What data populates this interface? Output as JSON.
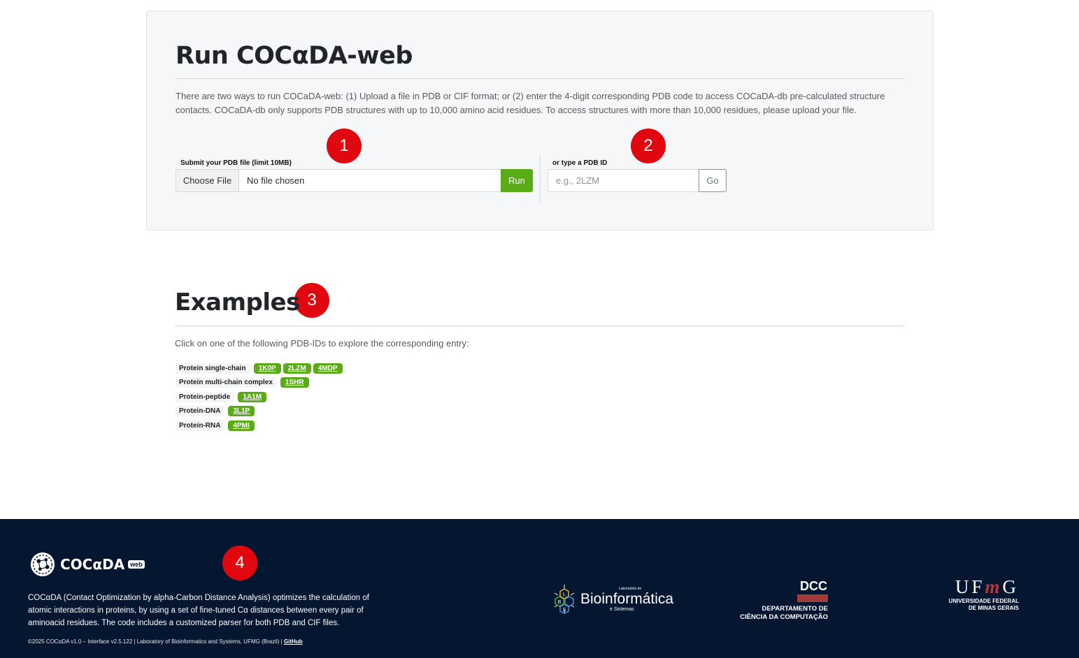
{
  "run": {
    "title": "Run COCαDA-web",
    "description": "There are two ways to run COCaDA-web: (1) Upload a file in PDB or CIF format; or (2) enter the 4-digit corresponding PDB code to access COCaDA-db pre-calculated structure contacts. COCaDA-db only supports PDB structures with up to 10,000 amino acid residues. To access structures with more than 10,000 residues, please upload your file.",
    "file_label": "Submit your PDB file (limit 10MB)",
    "choose_label": "Choose File",
    "file_status": "No file chosen",
    "run_label": "Run",
    "pdb_label": "or type a PDB ID",
    "pdb_placeholder": "e.g., 2LZM",
    "go_label": "Go"
  },
  "markers": [
    "1",
    "2",
    "3",
    "4"
  ],
  "examples": {
    "title": "Examples",
    "intro": "Click on one of the following PDB-IDs to explore the corresponding entry:",
    "rows": [
      {
        "category": "Protein single-chain",
        "ids": [
          "1K0P",
          "2LZM",
          "4MDP"
        ]
      },
      {
        "category": "Protein multi-chain complex",
        "ids": [
          "1SHR"
        ]
      },
      {
        "category": "Protein-peptide",
        "ids": [
          "1A1M"
        ]
      },
      {
        "category": "Protein-DNA",
        "ids": [
          "3L1P"
        ]
      },
      {
        "category": "Protein-RNA",
        "ids": [
          "4PMI"
        ]
      }
    ]
  },
  "footer": {
    "logo_text": "COCαDA",
    "logo_badge": "web",
    "description": "COCαDA (Contact Optimization by alpha-Carbon Distance Analysis) optimizes the calculation of atomic interactions in proteins, by using a set of fine-tuned Cα distances between every pair of aminoacid residues. The code includes a customized parser for both PDB and CIF files.",
    "copyright": "©2025 COCαDA v1.0 – Interface v2.5.122 | Laboratory of Bioinformatics and Systems, UFMG (Brazil) | ",
    "github_label": "GitHub",
    "lbs_name": "Bioinformática",
    "lbs_small": "Laboratório de",
    "lbs_sub": "e Sistemas",
    "dcc_title": "DCC",
    "dcc_line1": "DEPARTAMENTO DE",
    "dcc_line2": "CIÊNCIA DA COMPUTAÇÃO",
    "ufmg_u": "U",
    "ufmg_f": "F",
    "ufmg_m": "m",
    "ufmg_g": "G",
    "ufmg_line1": "UNIVERSIDADE FEDERAL",
    "ufmg_line2": "DE MINAS GERAIS",
    "colors": {
      "accent": "#5aac16",
      "marker": "#e0070f",
      "footer_bg": "#051630",
      "dcc_red": "#a33a3a"
    }
  }
}
